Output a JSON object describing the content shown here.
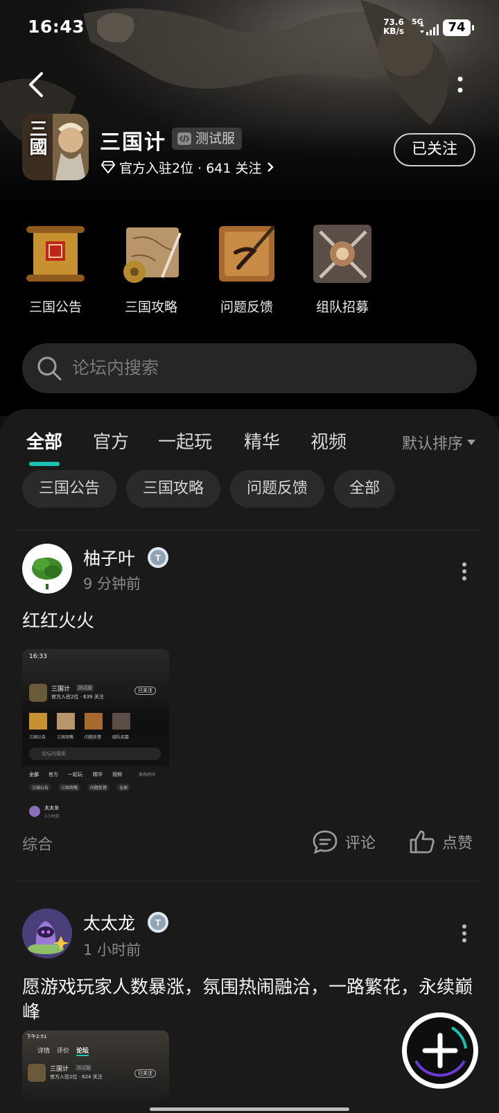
{
  "status_bar": {
    "time": "16:43",
    "net_speed_value": "73.6",
    "net_speed_unit": "KB/s",
    "network": "5G",
    "battery": "74"
  },
  "header": {
    "app_name": "三国计",
    "badge": "测试服",
    "rank_text": "官方入驻2位 · 641 关注",
    "follow_label": "已关注",
    "icon_text": "三國"
  },
  "quick_links": [
    {
      "label": "三国公告",
      "icon": "scroll-icon"
    },
    {
      "label": "三国攻略",
      "icon": "map-icon"
    },
    {
      "label": "问题反馈",
      "icon": "brush-icon"
    },
    {
      "label": "组队招募",
      "icon": "weapons-icon"
    }
  ],
  "search": {
    "placeholder": "论坛内搜索"
  },
  "tabs": [
    "全部",
    "官方",
    "一起玩",
    "精华",
    "视频"
  ],
  "active_tab": "全部",
  "sort_label": "默认排序",
  "chips": [
    "三国公告",
    "三国攻略",
    "问题反馈",
    "全部"
  ],
  "posts": [
    {
      "user": "柚子叶",
      "time": "9 分钟前",
      "text": "红红火火",
      "category": "综合",
      "comment_label": "评论",
      "like_label": "点赞",
      "thumb": {
        "time": "16:33",
        "app_name": "三国计",
        "badge": "测试服",
        "rank": "官方入驻2位 · 639 关注",
        "follow": "已关注",
        "links": [
          "三国公告",
          "三国攻略",
          "问题反馈",
          "组队招募"
        ],
        "search": "论坛内搜索",
        "tabs": [
          "全部",
          "官方",
          "一起玩",
          "精华",
          "视频"
        ],
        "sort": "发布时间",
        "chips": [
          "三国公告",
          "三国攻略",
          "问题反馈",
          "全部"
        ],
        "user": "太太龙",
        "user_time": "1小时前"
      }
    },
    {
      "user": "太太龙",
      "time": "1 小时前",
      "text": "愿游戏玩家人数暴涨，氛围热闹融洽，一路繁花，永续巅峰",
      "thumb": {
        "time": "下午2:51",
        "tabs": [
          "详情",
          "评价",
          "论坛"
        ],
        "app_name": "三国计",
        "badge": "测试服",
        "rank": "官方入驻2位 · 624 关注",
        "follow": "已关注"
      }
    }
  ],
  "colors": {
    "accent": "#18c3b3",
    "background": "#1a1a1a",
    "hero": "#000000"
  }
}
